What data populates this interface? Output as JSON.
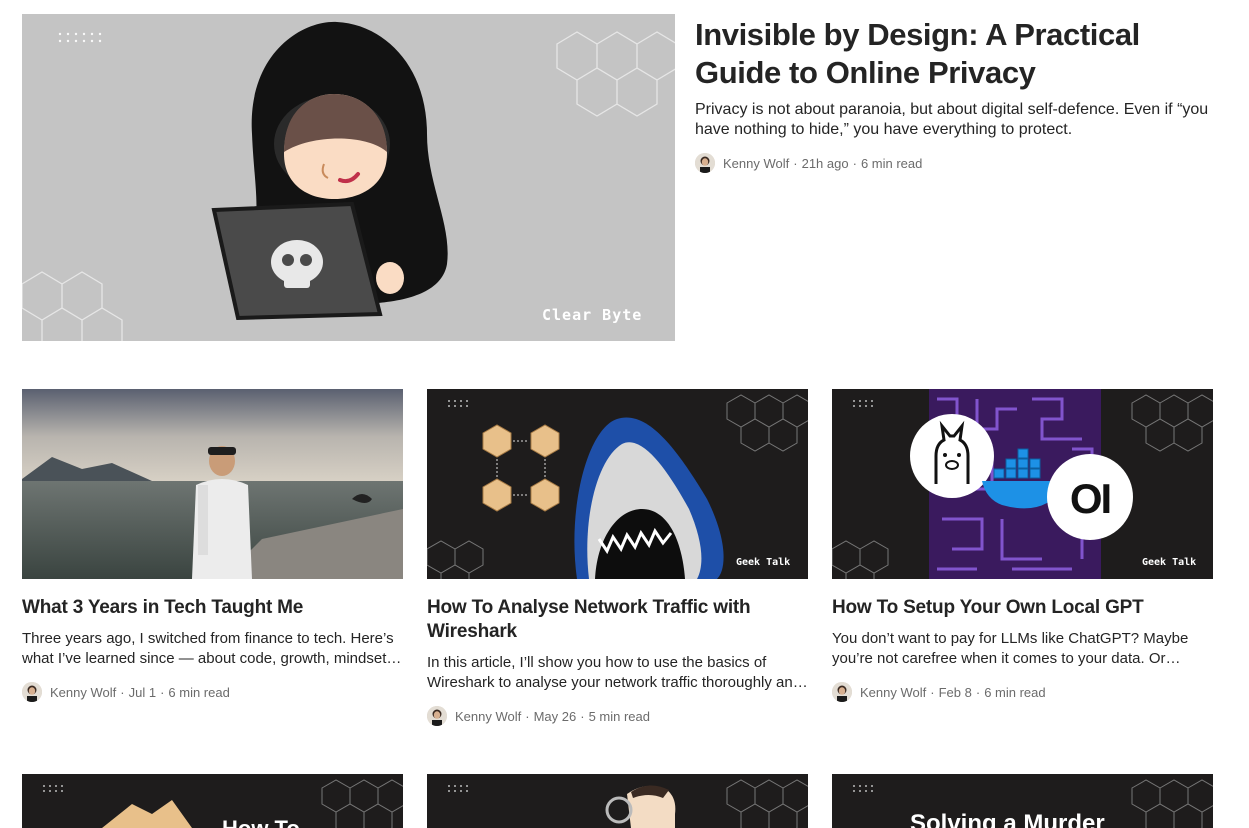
{
  "featured": {
    "title": "Invisible by Design: A Practical Guide to Online Privacy",
    "subtitle": "Privacy is not about paranoia, but about digital self-defence. Even if “you have nothing to hide,” you have everything to protect.",
    "image_brand": "Clear Byte",
    "author": "Kenny Wolf",
    "date": "21h ago",
    "read_time": "6 min read"
  },
  "cards": [
    {
      "title": "What 3 Years in Tech Taught Me",
      "subtitle": "Three years ago, I switched from finance to tech. Here’s what I’ve learned since — about code, growth, mindset, and finding your own path.",
      "author": "Kenny Wolf",
      "date": "Jul 1",
      "read_time": "6 min read"
    },
    {
      "title": "How To Analyse Network Traffic with Wireshark",
      "subtitle": "In this article, I’ll show you how to use the basics of Wireshark to analyse your network traffic thoroughly and effectively.",
      "image_brand": "Geek Talk",
      "author": "Kenny Wolf",
      "date": "May 26",
      "read_time": "5 min read"
    },
    {
      "title": "How To Setup Your Own Local GPT",
      "subtitle": "You don’t want to pay for LLMs like ChatGPT? Maybe you’re not carefree when it comes to your data. Or maybe you just want to tinker.",
      "image_brand": "Geek Talk",
      "image_logo_text": "OI",
      "author": "Kenny Wolf",
      "date": "Feb 8",
      "read_time": "6 min read"
    }
  ],
  "row3": [
    {
      "image_text": "How To"
    },
    {
      "image_text": ""
    },
    {
      "image_text": "Solving a Murder"
    }
  ],
  "colors": {
    "text": "#242424",
    "meta": "#6b6b6b",
    "dark_thumb": "#1e1c1c",
    "hero_bg": "#c4c4c4"
  }
}
